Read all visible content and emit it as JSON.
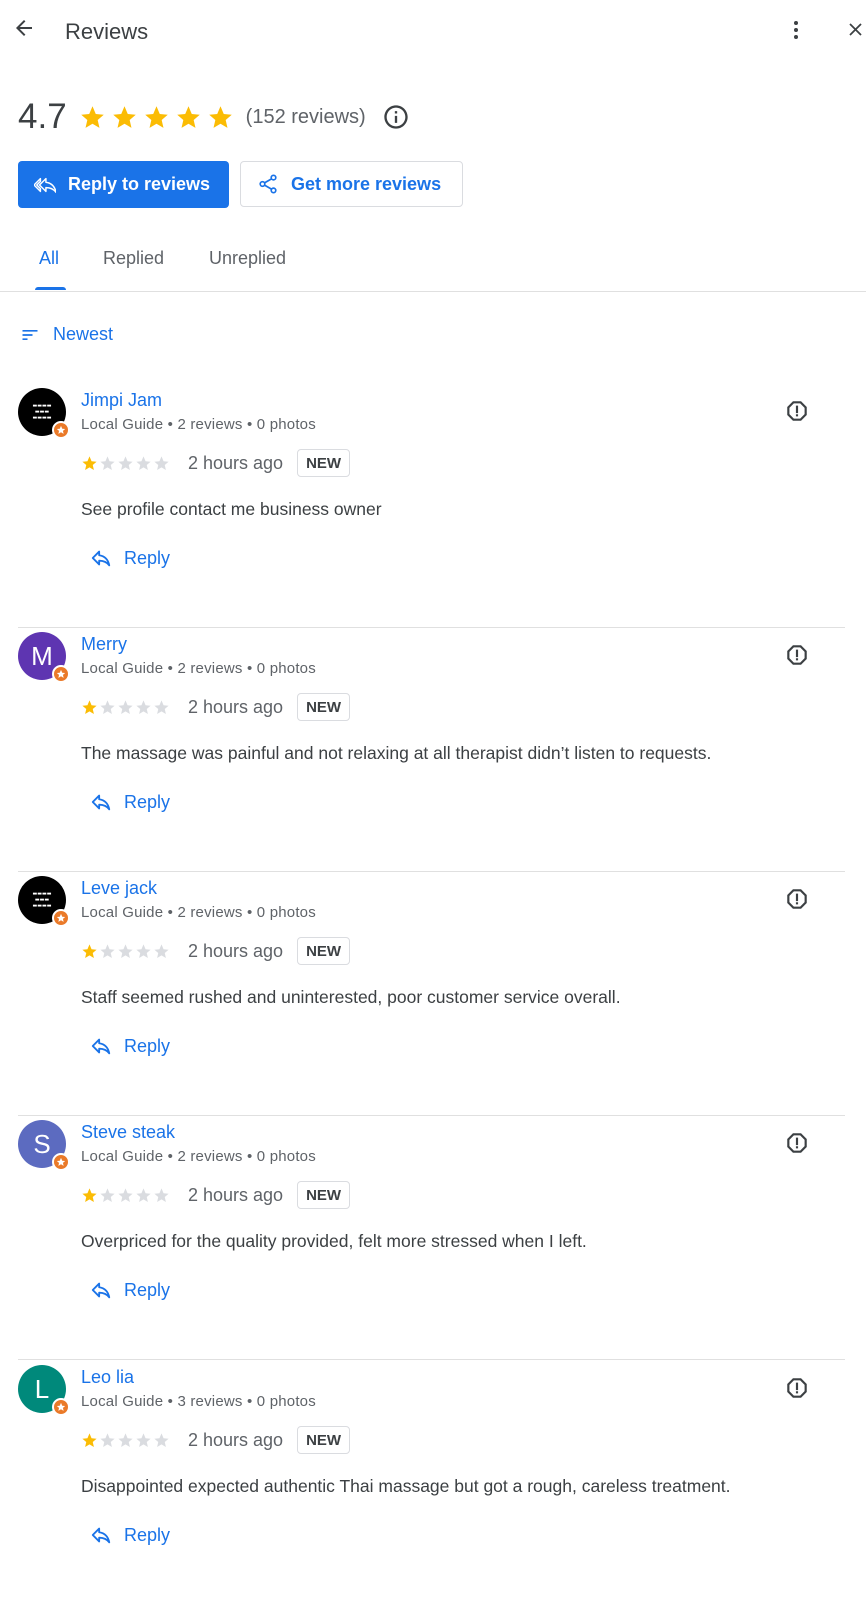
{
  "header": {
    "title": "Reviews",
    "back_icon": "arrow-back-icon",
    "more_icon": "more-vert-icon",
    "close_icon": "close-icon"
  },
  "summary": {
    "rating": "4.7",
    "stars": 5,
    "review_count": "(152 reviews)",
    "info_icon": "info-icon"
  },
  "actions": {
    "reply_label": "Reply to reviews",
    "get_more_label": "Get more reviews"
  },
  "tabs": [
    {
      "label": "All",
      "active": true
    },
    {
      "label": "Replied",
      "active": false
    },
    {
      "label": "Unreplied",
      "active": false
    }
  ],
  "sort": {
    "label": "Newest"
  },
  "reviews": [
    {
      "name": "Jimpi Jam",
      "meta": "Local Guide • 2 reviews • 0 photos",
      "rating": 1,
      "time": "2 hours ago",
      "badge": "NEW",
      "text": "See profile contact me business owner",
      "reply_label": "Reply",
      "avatar_letter": "",
      "avatar_color": "#000000"
    },
    {
      "name": "Merry",
      "meta": "Local Guide • 2 reviews • 0 photos",
      "rating": 1,
      "time": "2 hours ago",
      "badge": "NEW",
      "text": "The massage was painful and not relaxing at all therapist didn’t listen to requests.",
      "reply_label": "Reply",
      "avatar_letter": "M",
      "avatar_color": "#5e35b1"
    },
    {
      "name": "Leve jack",
      "meta": "Local Guide • 2 reviews • 0 photos",
      "rating": 1,
      "time": "2 hours ago",
      "badge": "NEW",
      "text": "Staff seemed rushed and uninterested, poor customer service overall.",
      "reply_label": "Reply",
      "avatar_letter": "",
      "avatar_color": "#000000"
    },
    {
      "name": "Steve steak",
      "meta": "Local Guide • 2 reviews • 0 photos",
      "rating": 1,
      "time": "2 hours ago",
      "badge": "NEW",
      "text": "Overpriced for the quality provided, felt more stressed when I left.",
      "reply_label": "Reply",
      "avatar_letter": "S",
      "avatar_color": "#5c6bc0"
    },
    {
      "name": "Leo lia",
      "meta": "Local Guide • 3 reviews • 0 photos",
      "rating": 1,
      "time": "2 hours ago",
      "badge": "NEW",
      "text": "Disappointed expected authentic Thai massage but got a rough, careless treatment.",
      "reply_label": "Reply",
      "avatar_letter": "L",
      "avatar_color": "#00897b"
    }
  ],
  "colors": {
    "accent": "#1a73e8",
    "star": "#fbbc04",
    "star_empty": "#dadce0",
    "guide_badge": "#ea7a29"
  }
}
